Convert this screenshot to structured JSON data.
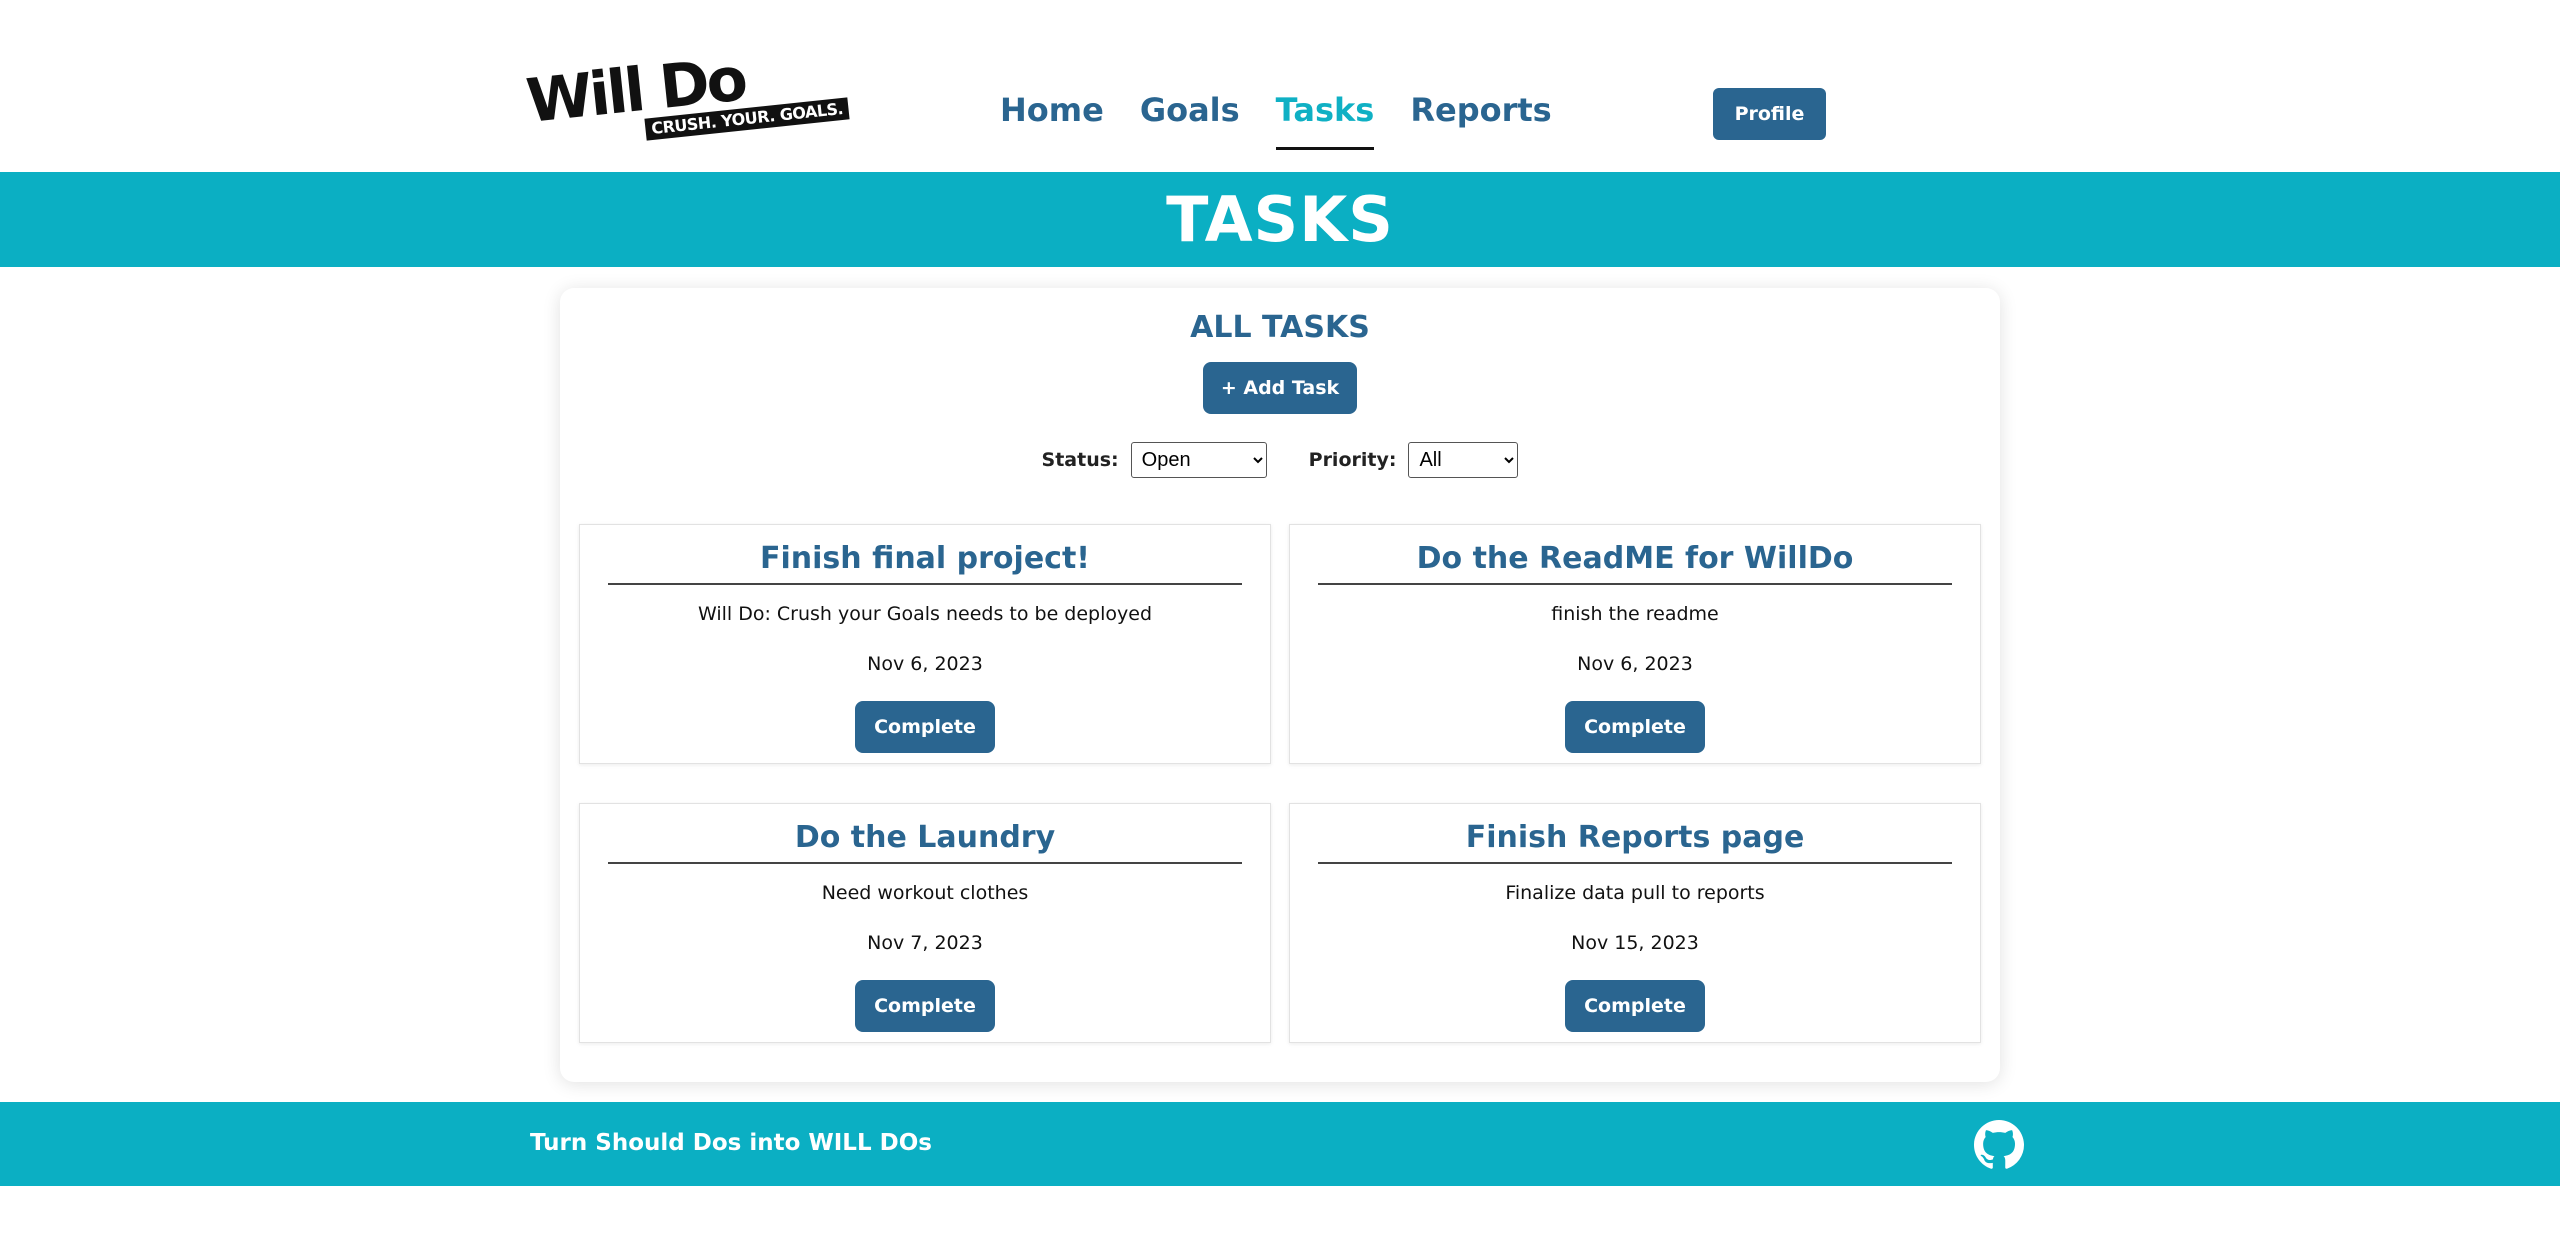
{
  "header": {
    "logo": {
      "main": "Will Do",
      "tagline": "CRUSH. YOUR. GOALS."
    },
    "nav": [
      {
        "label": "Home"
      },
      {
        "label": "Goals"
      },
      {
        "label": "Tasks"
      },
      {
        "label": "Reports"
      }
    ],
    "active_nav": "Tasks",
    "profile_label": "Profile"
  },
  "banner": {
    "title": "TASKS"
  },
  "panel": {
    "title": "ALL TASKS",
    "add_label": "+ Add Task",
    "filters": {
      "status_label": "Status:",
      "status_value": "Open",
      "priority_label": "Priority:",
      "priority_value": "All"
    }
  },
  "tasks": [
    {
      "title": "Finish final project!",
      "description": "Will Do: Crush your Goals needs to be deployed",
      "date": "Nov 6, 2023",
      "action": "Complete"
    },
    {
      "title": "Do the ReadME for WillDo",
      "description": "finish the readme",
      "date": "Nov 6, 2023",
      "action": "Complete"
    },
    {
      "title": "Do the Laundry",
      "description": "Need workout clothes",
      "date": "Nov 7, 2023",
      "action": "Complete"
    },
    {
      "title": "Finish Reports page",
      "description": "Finalize data pull to reports",
      "date": "Nov 15, 2023",
      "action": "Complete"
    }
  ],
  "footer": {
    "text": "Turn Should Dos into WILL DOs",
    "icon": "github-icon"
  },
  "colors": {
    "primary": "#2a6590",
    "accent": "#0bafc3",
    "active_nav": "#0fb0c4"
  }
}
